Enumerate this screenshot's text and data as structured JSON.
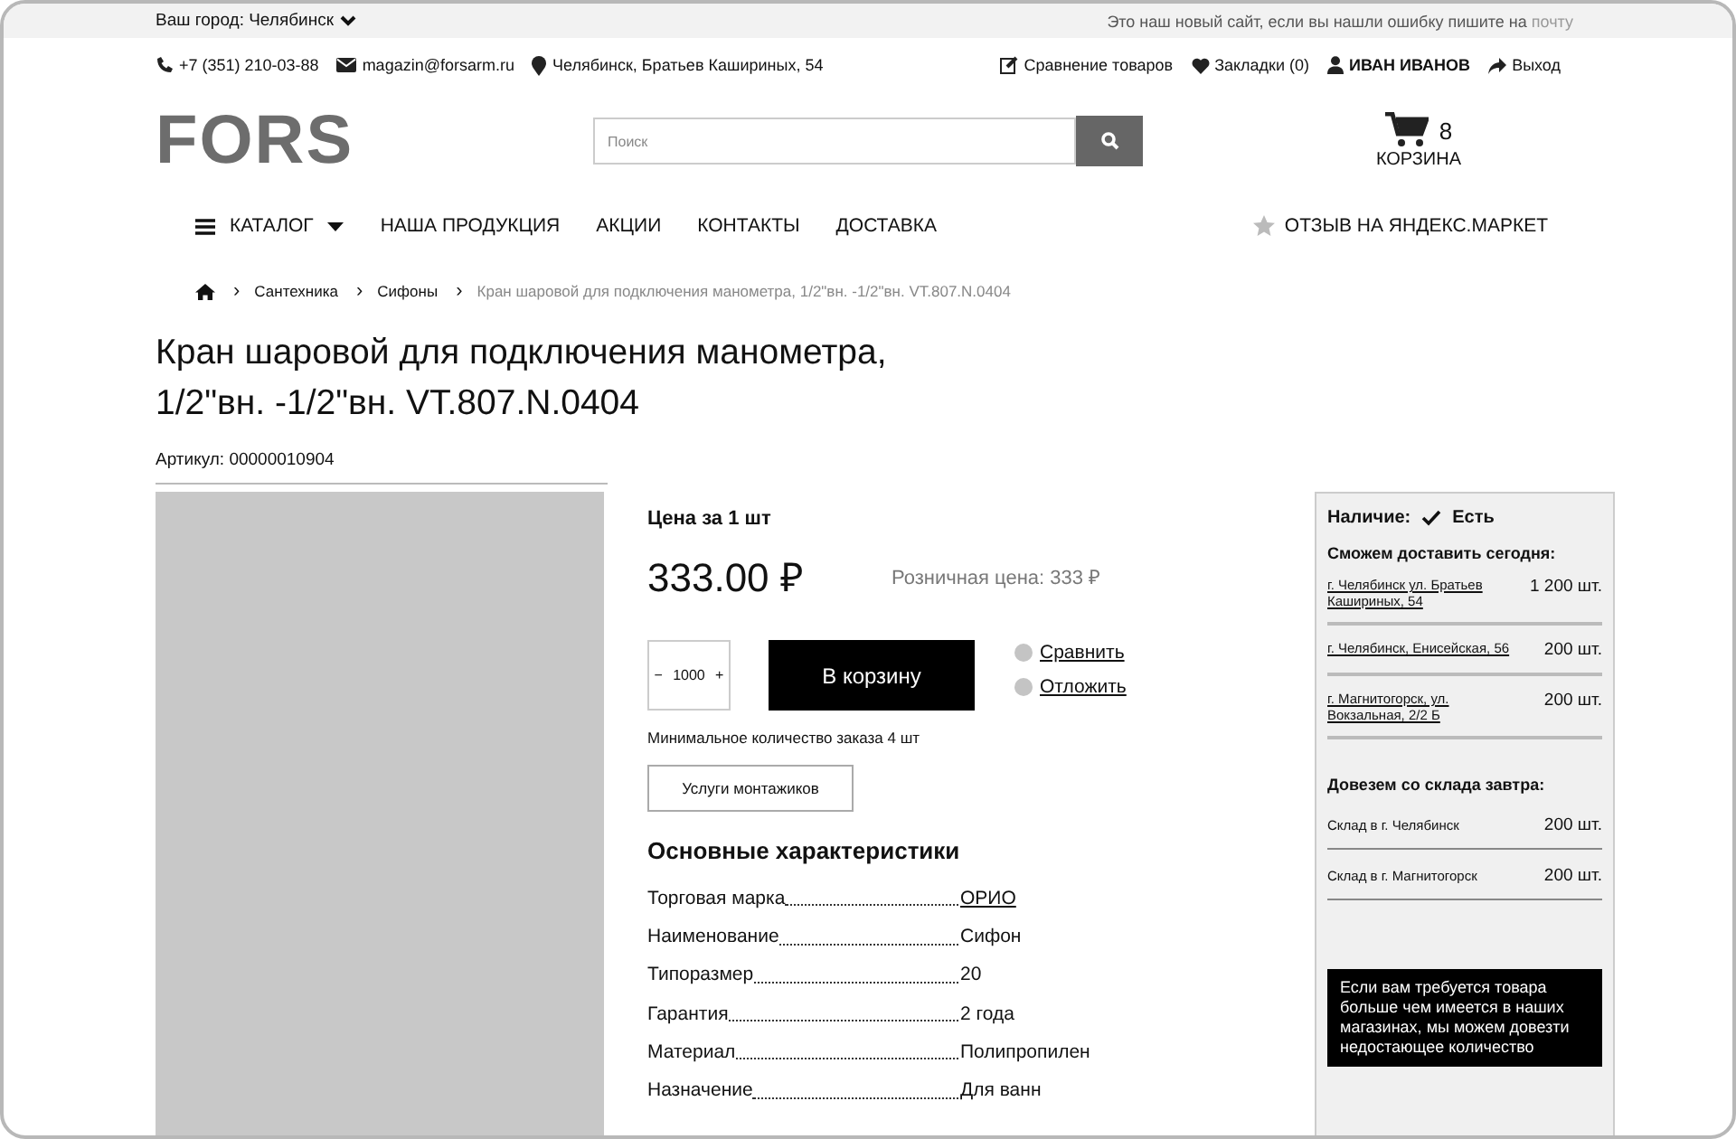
{
  "top_bar": {
    "city_label": "Ваш город: Челябинск",
    "notice": "Это наш новый сайт, если вы нашли ошибку пишите на",
    "notice_link": "почту"
  },
  "contacts": {
    "phone": "+7 (351) 210-03-88",
    "email": "magazin@forsarm.ru",
    "address": "Челябинск, Братьев Кашириных, 54"
  },
  "user_links": {
    "compare": "Сравнение товаров",
    "bookmarks": "Закладки (0)",
    "user": "ИВАН ИВАНОВ",
    "logout": "Выход"
  },
  "logo": "FORS",
  "search": {
    "placeholder": "Поиск"
  },
  "cart": {
    "count": "8",
    "label": "КОРЗИНА"
  },
  "nav": {
    "catalog": "КАТАЛОГ",
    "items": [
      "НАША ПРОДУКЦИЯ",
      "АКЦИИ",
      "КОНТАКТЫ",
      "ДОСТАВКА"
    ],
    "review": "ОТЗЫВ НА ЯНДЕКС.МАРКЕТ"
  },
  "breadcrumb_separator": "›",
  "breadcrumbs": [
    {
      "label": "Сантехника",
      "current": false
    },
    {
      "label": "Сифоны",
      "current": false
    },
    {
      "label": "Кран шаровой для подключения манометра, 1/2\"вн. -1/2\"вн. VT.807.N.0404",
      "current": true
    }
  ],
  "product": {
    "title_lines": [
      "Кран шаровой для подключения манометра,",
      "1/2\"вн. -1/2\"вн. VT.807.N.0404"
    ],
    "article": "Артикул: 00000010904",
    "image": {
      "kind": "placeholder"
    },
    "price_label": "Цена за 1 шт",
    "price": "333.00 ₽",
    "retail_price": "Розничная цена: 333 ₽",
    "quantity": {
      "minus": "−",
      "value": "1000",
      "plus": "+"
    },
    "add_to_cart": "В корзину",
    "actions": [
      "Сравнить",
      "Отложить"
    ],
    "min_order": "Минимальное количество заказа 4 шт",
    "installers": "Услуги монтажиков",
    "specs_title": "Основные характеристики",
    "specs": [
      {
        "name": "Торговая марка",
        "value": "ОРИО",
        "link": true
      },
      {
        "name": "Наименование",
        "value": "Сифон",
        "link": false
      },
      {
        "name": "Типоразмер",
        "value": "20",
        "link": false
      },
      {
        "name": "Гарантия",
        "value": "2 года",
        "link": false
      },
      {
        "name": "Материал",
        "value": "Полипропилен",
        "link": false
      },
      {
        "name": "Назначение",
        "value": "Для ванн",
        "link": false
      }
    ]
  },
  "availability": {
    "label": "Наличие:",
    "status": "Есть",
    "today_title": "Сможем доставить сегодня:",
    "stores": [
      {
        "address": "г. Челябинск ул. Братьев Кашириных, 54",
        "qty": "1 200 шт."
      },
      {
        "address": "г. Челябинск, Енисейская, 56",
        "qty": "200 шт."
      },
      {
        "address": "г. Магнитогорск, ул. Вокзальная, 2/2 Б",
        "qty": "200 шт."
      }
    ],
    "tomorrow_title": "Довезем со склада завтра:",
    "warehouses": [
      {
        "name": "Склад в г. Челябинск",
        "qty": "200 шт."
      },
      {
        "name": "Склад в г. Магнитогорск",
        "qty": "200 шт."
      }
    ],
    "note": "Если вам требуется товара больше чем имеется в наших магазинах, мы можем довезти недостающее количество"
  }
}
